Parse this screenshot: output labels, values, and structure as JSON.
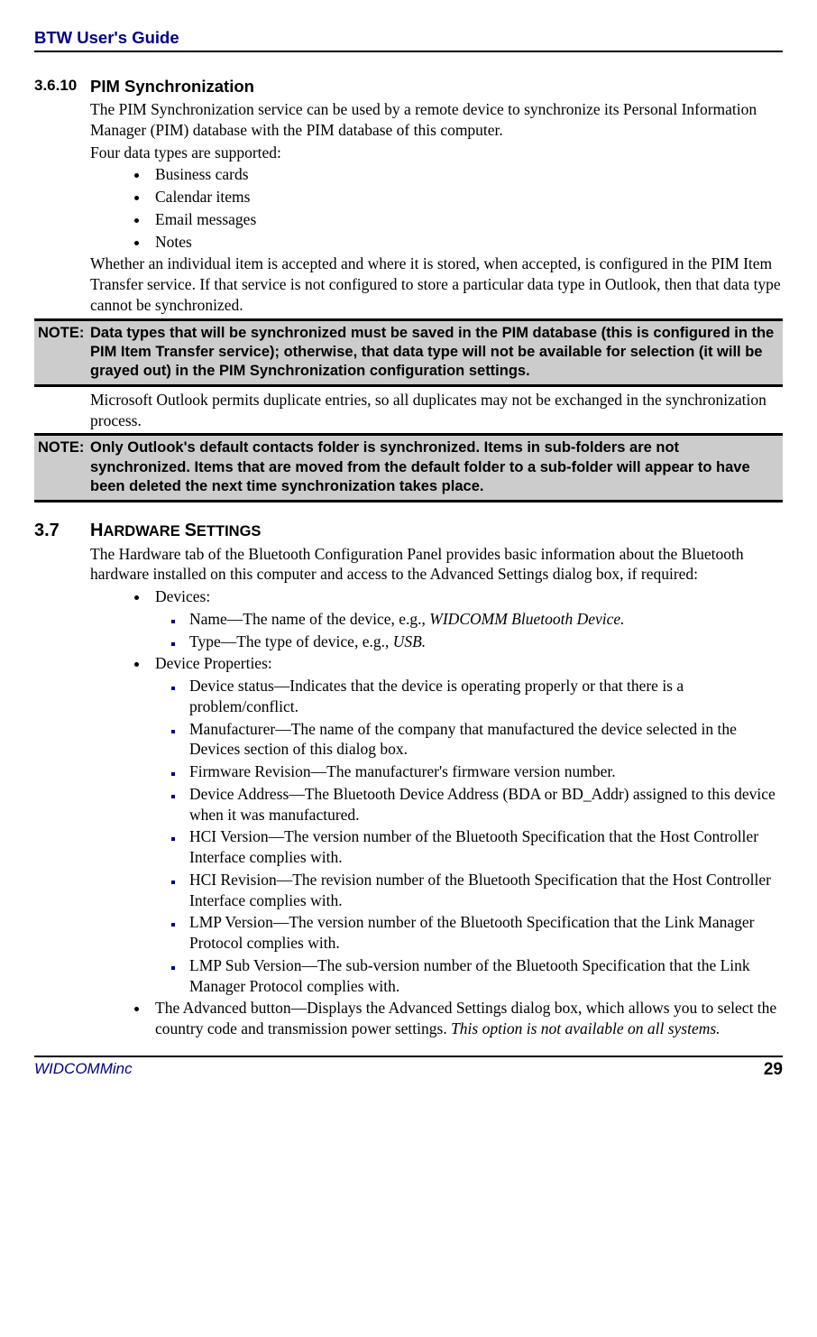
{
  "header": {
    "title": "BTW User's Guide"
  },
  "section1": {
    "num": "3.6.10",
    "title": "PIM Synchronization",
    "p1": "The PIM Synchronization service can be used by a remote device to synchronize its Personal Information Manager (PIM) database with the PIM database of this computer.",
    "p2": "Four data types are supported:",
    "bullets": [
      "Business cards",
      "Calendar items",
      "Email messages",
      "Notes"
    ],
    "p3": "Whether an individual item is accepted and where it is stored, when accepted, is configured in the PIM Item Transfer service. If that service is not configured to store a particular data type in Outlook, then that data type cannot be synchronized.",
    "p4": "Microsoft Outlook permits duplicate entries, so all duplicates may not be exchanged in the synchronization process."
  },
  "note1": {
    "label": "NOTE:",
    "text": "Data types that will be synchronized must be saved in the PIM database (this is configured in the PIM Item Transfer service); otherwise, that data type will not be available for selection (it will be grayed out) in the PIM Synchronization configuration settings."
  },
  "note2": {
    "label": "NOTE:",
    "text": "Only Outlook's default contacts folder is synchronized. Items in sub-folders are not synchronized. Items that are moved from the default folder to a sub-folder will appear to have been deleted the next time synchronization takes place."
  },
  "section2": {
    "num": "3.7",
    "title_caps1": "H",
    "title_small1": "ARDWARE",
    "title_caps2": "S",
    "title_small2": "ETTINGS",
    "p1": "The Hardware tab of the Bluetooth Configuration Panel provides basic information about the Bluetooth hardware installed on this computer and access to the Advanced Settings dialog box, if required:",
    "b1": "Devices:",
    "b1_subs": [
      {
        "pre": "Name—The name of the device, e.g., ",
        "ital": "WIDCOMM Bluetooth Device."
      },
      {
        "pre": "Type—The type of device, e.g., ",
        "ital": "USB.",
        "post": ""
      }
    ],
    "b2": "Device Properties:",
    "b2_subs": [
      "Device status—Indicates that the device is operating properly or that there is a problem/conflict.",
      "Manufacturer—The name of the company that manufactured the device selected in the Devices section of this dialog box.",
      "Firmware Revision—The manufacturer's firmware version number.",
      "Device Address—The Bluetooth Device Address (BDA or BD_Addr) assigned to this device when it was manufactured.",
      "HCI Version—The version number of the Bluetooth Specification that the Host Controller Interface complies with.",
      "HCI Revision—The revision number of the Bluetooth Specification that the Host Controller Interface complies with.",
      "LMP Version—The version number of the Bluetooth Specification that the Link Manager Protocol complies with.",
      "LMP Sub Version—The sub-version number of the Bluetooth Specification that the Link Manager Protocol complies with."
    ],
    "b3_pre": "The Advanced button—Displays the Advanced Settings dialog box, which allows you to select the country code and transmission power settings. ",
    "b3_ital": "This option is not available on all systems."
  },
  "footer": {
    "left": "WIDCOMMinc",
    "right": "29"
  }
}
